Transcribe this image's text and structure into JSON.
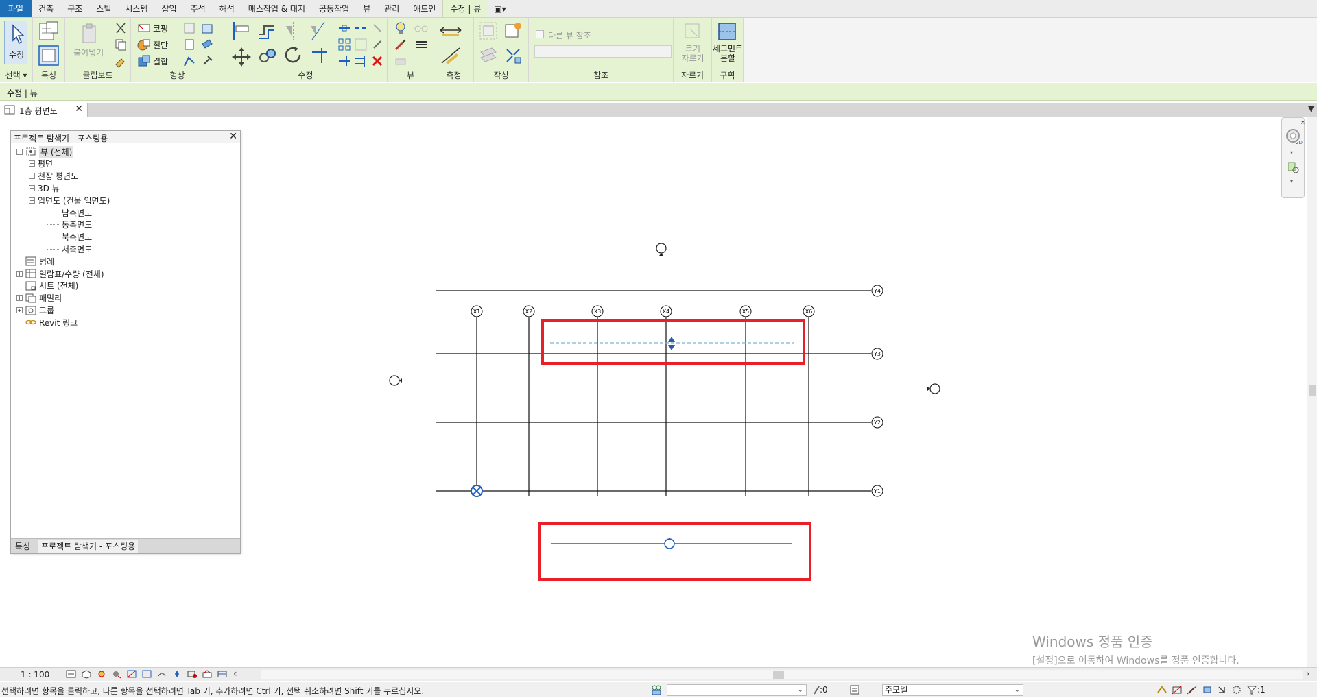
{
  "tabs": [
    "파일",
    "건축",
    "구조",
    "스틸",
    "시스템",
    "삽입",
    "주석",
    "해석",
    "매스작업 & 대지",
    "공동작업",
    "뷰",
    "관리",
    "애드인",
    "수정 | 뷰"
  ],
  "tab_extra": "▣▾",
  "ribbon": {
    "select": {
      "button": "수정",
      "label": "선택 ▾"
    },
    "properties": {
      "label": "특성"
    },
    "clipboard": {
      "paste": "붙여넣기",
      "label": "클립보드"
    },
    "geometry": {
      "cope": "코핑",
      "cut": "절단",
      "join": "결합",
      "label": "형상"
    },
    "modify": {
      "label": "수정"
    },
    "view": {
      "label": "뷰"
    },
    "measure": {
      "label": "측정"
    },
    "create": {
      "label": "작성"
    },
    "reference": {
      "other_view": "다른 뷰 참조",
      "label": "참조"
    },
    "crop": {
      "size_crop": "크기\n자르기",
      "label": "자르기"
    },
    "region": {
      "split_segment": "세그먼트\n분할",
      "label": "구획"
    }
  },
  "context_bar": "수정 | 뷰",
  "view_tab": {
    "label": "1층 평면도"
  },
  "browser": {
    "title": "프로젝트 탐색기 - 포스팅용",
    "nodes": [
      {
        "label": "뷰 (전체)",
        "level": 0,
        "exp": "−",
        "selected": true,
        "icon": "views-icon"
      },
      {
        "label": "평면",
        "level": 1,
        "exp": "+"
      },
      {
        "label": "천장 평면도",
        "level": 1,
        "exp": "+"
      },
      {
        "label": "3D 뷰",
        "level": 1,
        "exp": "+"
      },
      {
        "label": "입면도 (건물 입면도)",
        "level": 1,
        "exp": "−"
      },
      {
        "label": "남측면도",
        "level": 2
      },
      {
        "label": "동측면도",
        "level": 2
      },
      {
        "label": "북측면도",
        "level": 2
      },
      {
        "label": "서측면도",
        "level": 2
      },
      {
        "label": "범례",
        "level": 0,
        "icon": "legend-icon"
      },
      {
        "label": "일람표/수량 (전체)",
        "level": 0,
        "exp": "+",
        "icon": "schedule-icon"
      },
      {
        "label": "시트 (전체)",
        "level": 0,
        "icon": "sheet-icon"
      },
      {
        "label": "패밀리",
        "level": 0,
        "exp": "+",
        "icon": "family-icon"
      },
      {
        "label": "그룹",
        "level": 0,
        "exp": "+",
        "icon": "group-icon"
      },
      {
        "label": "Revit 링크",
        "level": 0,
        "icon": "link-icon"
      }
    ],
    "bottom_tabs": [
      "특성",
      "프로젝트 탐색기 - 포스팅용"
    ]
  },
  "grid": {
    "x_labels": [
      "X1",
      "X2",
      "X3",
      "X4",
      "X5",
      "X6"
    ],
    "y_labels": [
      "Y4",
      "Y3",
      "Y2",
      "Y1"
    ]
  },
  "watermark": {
    "line1": "Windows 정품 인증",
    "line2": "[설정]으로 이동하여 Windows를 정품 인증합니다."
  },
  "view_control": {
    "scale": "1 : 100"
  },
  "status": {
    "message": "선택하려면 항목을 클릭하고, 다른 항목을 선택하려면 Tab 키, 추가하려면 Ctrl 키, 선택 취소하려면 Shift 키를 누르십시오.",
    "workset_count": ":0",
    "model": "주모델",
    "filter_count": ":1"
  },
  "colors": {
    "file_tab": "#1d6fb8",
    "context_green": "#e6f3d2",
    "highlight_red": "#e8202a",
    "selected_blue": "#1f5fbf",
    "section_dashed": "#7fb2d8"
  }
}
